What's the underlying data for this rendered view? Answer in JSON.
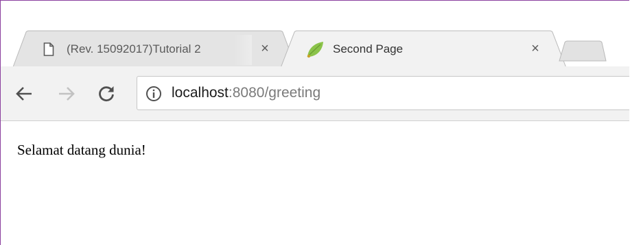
{
  "browser": {
    "tabs": [
      {
        "title": "(Rev. 15092017)Tutorial 2",
        "icon": "page-icon",
        "active": false
      },
      {
        "title": "Second Page",
        "icon": "spring-leaf-icon",
        "active": true
      }
    ],
    "new_tab_icon": "new-tab-icon",
    "close_glyph": "×"
  },
  "toolbar": {
    "back_icon": "back-arrow-icon",
    "forward_icon": "forward-arrow-icon",
    "reload_icon": "reload-icon",
    "info_icon": "info-icon",
    "url_host": "localhost",
    "url_rest": ":8080/greeting"
  },
  "page": {
    "body_text": "Selamat datang dunia!"
  },
  "colors": {
    "frame_border": "#8a3f9e",
    "toolbar_bg": "#f2f2f2",
    "inactive_tab_bg": "#e4e4e4",
    "active_tab_bg": "#f2f2f2",
    "leaf_green": "#8bc34a"
  }
}
